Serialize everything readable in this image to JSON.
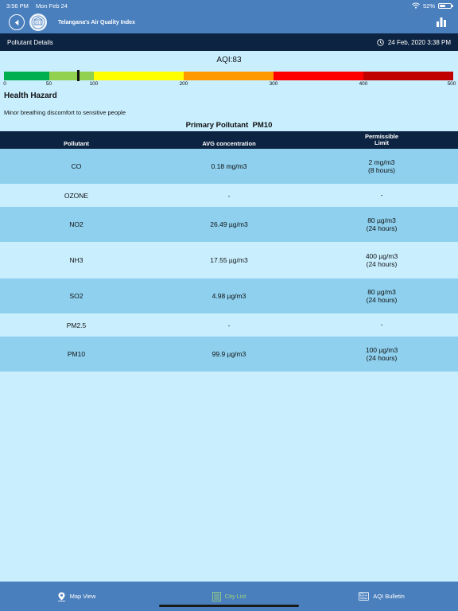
{
  "status_bar": {
    "time": "3:56 PM",
    "date": "Mon Feb 24",
    "battery": "52%",
    "battery_level": 0.52
  },
  "header": {
    "title": "Telangana's Air Quality Index"
  },
  "subheader": {
    "title": "Pollutant Details",
    "timestamp": "24 Feb, 2020 3:38 PM"
  },
  "aqi": {
    "label": "AQI:83",
    "value": 83,
    "scale_max": 500,
    "ticks": [
      "0",
      "50",
      "100",
      "200",
      "300",
      "400",
      "500"
    ],
    "tick_values": [
      0,
      50,
      100,
      200,
      300,
      400,
      500
    ],
    "colors": [
      "#00b050",
      "#92d050",
      "#ffff00",
      "#ff9900",
      "#ff0000",
      "#c00000"
    ]
  },
  "health": {
    "title": "Health Hazard",
    "text": "Minor breathing discomfort to sensitive people"
  },
  "primary_pollutant": "Primary Pollutant  PM10",
  "table": {
    "headers": [
      "Pollutant",
      "AVG concentration",
      "Permissible\nLimit"
    ],
    "rows": [
      {
        "pollutant": "CO",
        "avg": "0.18 mg/m3",
        "limit": "2 mg/m3\n(8 hours)"
      },
      {
        "pollutant": "OZONE",
        "avg": "-",
        "limit": "-"
      },
      {
        "pollutant": "NO2",
        "avg": "26.49 µg/m3",
        "limit": "80 µg/m3\n(24 hours)"
      },
      {
        "pollutant": "NH3",
        "avg": "17.55 µg/m3",
        "limit": "400 µg/m3\n(24 hours)"
      },
      {
        "pollutant": "SO2",
        "avg": "4.98 µg/m3",
        "limit": "80 µg/m3\n(24 hours)"
      },
      {
        "pollutant": "PM2.5",
        "avg": "-",
        "limit": "-"
      },
      {
        "pollutant": "PM10",
        "avg": "99.9 µg/m3",
        "limit": "100 µg/m3\n(24 hours)"
      }
    ]
  },
  "tabs": [
    {
      "label": "Map View",
      "icon": "map-pin-icon",
      "active": false
    },
    {
      "label": "City List",
      "icon": "list-icon",
      "active": true
    },
    {
      "label": "AQI Bulletin",
      "icon": "bulletin-icon",
      "active": false
    }
  ],
  "colors": {
    "bar": "#4a7fbd",
    "dark": "#0c2341",
    "bg": "#c9efff",
    "row": "#8ed0ee",
    "active_tab": "#9fd67a"
  }
}
